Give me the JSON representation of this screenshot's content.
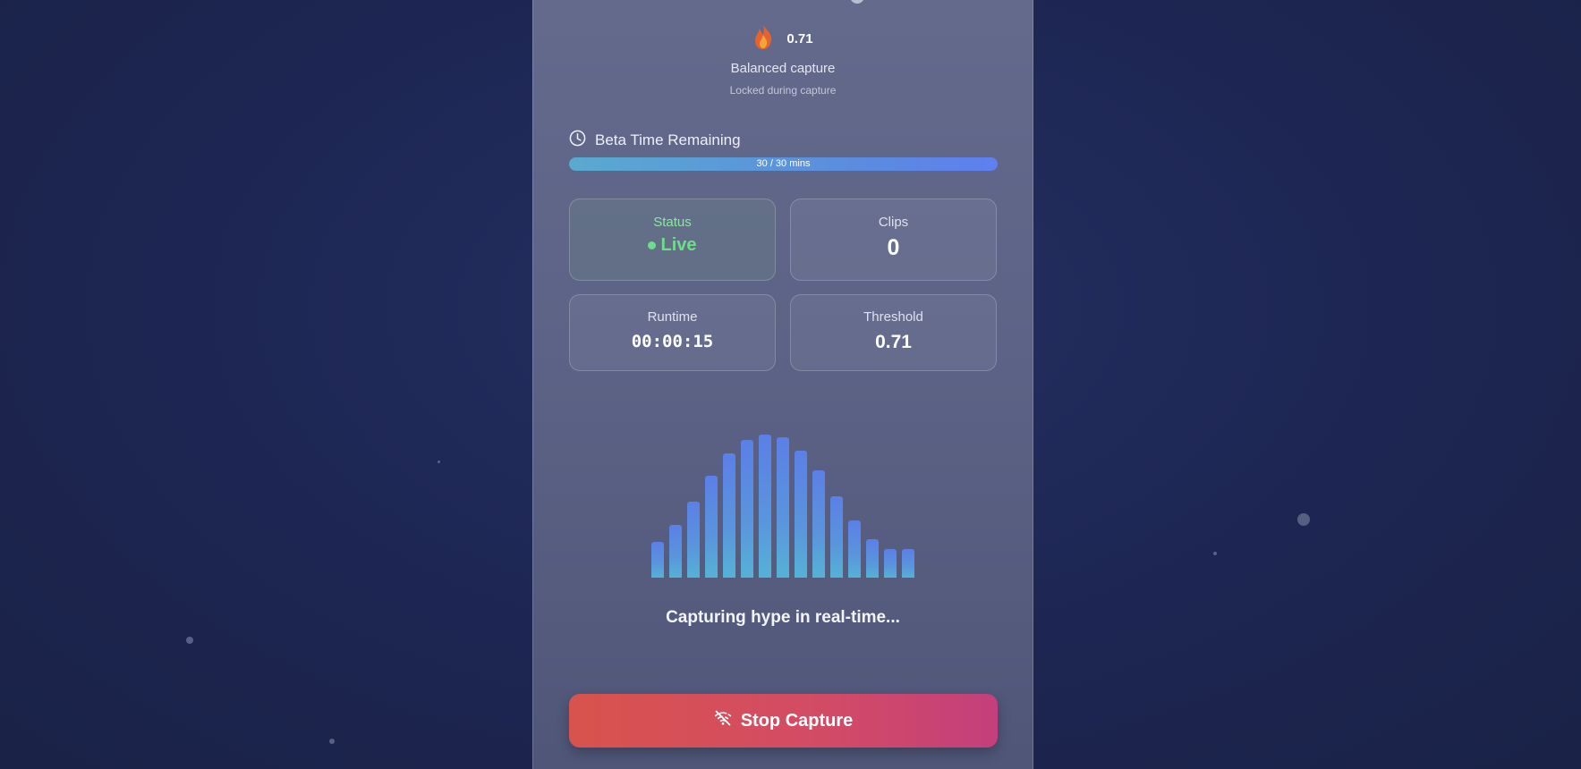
{
  "heat": {
    "icon": "fire-icon",
    "value": "0.71"
  },
  "mode": {
    "label": "Balanced capture",
    "lock_note": "Locked during capture"
  },
  "beta": {
    "icon": "clock-icon",
    "label": "Beta Time Remaining",
    "progress_text": "30 / 30 mins",
    "progress_fraction": 1.0
  },
  "stats": {
    "status": {
      "label": "Status",
      "value": "Live",
      "color": "#6fdc8a"
    },
    "clips": {
      "label": "Clips",
      "value": "0"
    },
    "runtime": {
      "label": "Runtime",
      "value": "00:00:15"
    },
    "threshold": {
      "label": "Threshold",
      "value": "0.71"
    }
  },
  "visualizer": {
    "levels": [
      0.25,
      0.37,
      0.53,
      0.71,
      0.87,
      0.96,
      1.0,
      0.98,
      0.89,
      0.75,
      0.57,
      0.4,
      0.27,
      0.2,
      0.2
    ]
  },
  "capture_message": "Capturing hype in real-time...",
  "stop_button": {
    "label": "Stop Capture",
    "icon": "wifi-off-icon"
  },
  "colors": {
    "accent": "#5b7fe6",
    "stop_start": "#d8534c",
    "stop_end": "#c43f7c",
    "live": "#6fdc8a"
  }
}
